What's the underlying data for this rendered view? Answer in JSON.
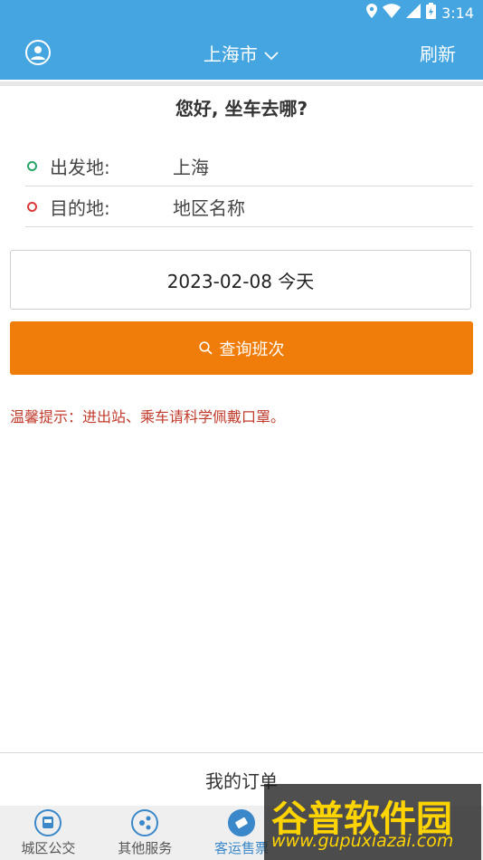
{
  "status_bar": {
    "time": "3:14"
  },
  "header": {
    "city": "上海市",
    "refresh_label": "刷新"
  },
  "greeting": "您好, 坐车去哪?",
  "origin": {
    "label": "出发地:",
    "value": "上海"
  },
  "destination": {
    "label": "目的地:",
    "placeholder": "地区名称"
  },
  "date": "2023-02-08 今天",
  "search_button": {
    "label": "查询班次"
  },
  "tip": "温馨提示：进出站、乘车请科学佩戴口罩。",
  "my_orders": "我的订单",
  "bottom_nav": {
    "items": [
      {
        "label": "城区公交"
      },
      {
        "label": "其他服务"
      },
      {
        "label": "客运售票"
      }
    ]
  },
  "watermark": {
    "title": "谷普软件园",
    "url": "www.gupuxiazai.com"
  },
  "colors": {
    "primary": "#45a5e0",
    "accent": "#f07d0a",
    "tip_red": "#c0392b",
    "nav_blue": "#3a88c9",
    "origin_dot": "#2aa568",
    "destination_dot": "#d93a3a"
  }
}
